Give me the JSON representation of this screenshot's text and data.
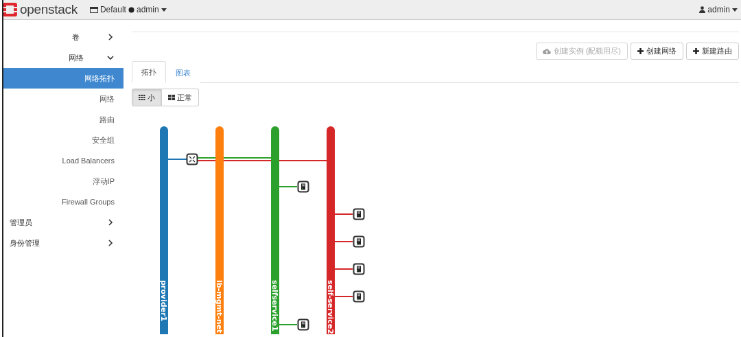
{
  "header": {
    "logo_text": "openstack",
    "domain": "Default",
    "project": "admin",
    "user": "admin"
  },
  "sidebar": {
    "items": [
      {
        "kind": "group",
        "label": "卷",
        "expanded": false
      },
      {
        "kind": "group",
        "label": "网络",
        "expanded": true,
        "children": [
          {
            "label": "网络拓扑",
            "selected": true
          },
          {
            "label": "网络",
            "selected": false
          },
          {
            "label": "路由",
            "selected": false
          },
          {
            "label": "安全组",
            "selected": false
          },
          {
            "label": "Load Balancers",
            "selected": false
          },
          {
            "label": "浮动IP",
            "selected": false
          },
          {
            "label": "Firewall Groups",
            "selected": false
          }
        ]
      },
      {
        "kind": "dashboard",
        "label": "管理员",
        "expanded": false
      },
      {
        "kind": "dashboard",
        "label": "身份管理",
        "expanded": false
      }
    ]
  },
  "actions": [
    {
      "kind": "launch",
      "label": "创建实例 (配额用尽)",
      "disabled": true
    },
    {
      "kind": "add",
      "label": "创建网络",
      "disabled": false
    },
    {
      "kind": "add",
      "label": "新建路由",
      "disabled": false
    }
  ],
  "tabs": [
    {
      "label": "拓扑",
      "selected": true
    },
    {
      "label": "图表",
      "selected": false
    }
  ],
  "view_toggle": [
    {
      "kind": "small",
      "label": "小",
      "selected": true
    },
    {
      "kind": "normal",
      "label": "正常",
      "selected": false
    }
  ],
  "topology": {
    "networks": [
      {
        "name": "provider1",
        "color": "#1f77b4",
        "router_link": true
      },
      {
        "name": "lb-mgmt-net",
        "color": "#ff7f0e",
        "router_link": false
      },
      {
        "name": "selfservice1",
        "color": "#2ca02c",
        "router_link": true
      },
      {
        "name": "self-service2",
        "color": "#d62728",
        "router_link": true
      }
    ],
    "instances": [
      {
        "color": "#2ca02c"
      },
      {
        "color": "#d62728"
      },
      {
        "color": "#d62728"
      },
      {
        "color": "#d62728"
      },
      {
        "color": "#d62728"
      },
      {
        "color": "#2ca02c"
      }
    ]
  }
}
